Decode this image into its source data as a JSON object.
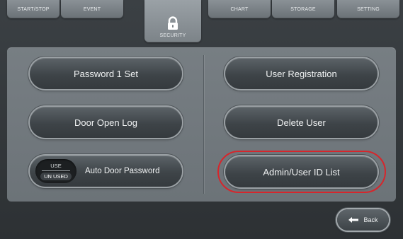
{
  "tabs": [
    {
      "label": "START/STOP"
    },
    {
      "label": "EVENT"
    },
    {
      "label": "SECURITY",
      "icon": "lock-icon"
    },
    {
      "label": "CHART"
    },
    {
      "label": "STORAGE"
    },
    {
      "label": "SETTING"
    }
  ],
  "left_buttons": {
    "password": "Password  1 Set",
    "door_open_log": "Door Open Log",
    "auto_door_password": "Auto Door Password"
  },
  "toggle": {
    "top": "USE",
    "bottom": "UN USED"
  },
  "right_buttons": {
    "user_registration": "User Registration",
    "delete_user": "Delete User",
    "admin_user_id_list": "Admin/User ID List"
  },
  "footer": {
    "back_label": "Back",
    "back_icon": "back-arrow-icon"
  },
  "colors": {
    "highlight": "#d6262c",
    "panel": "#72797e",
    "button": "#3e4448"
  }
}
